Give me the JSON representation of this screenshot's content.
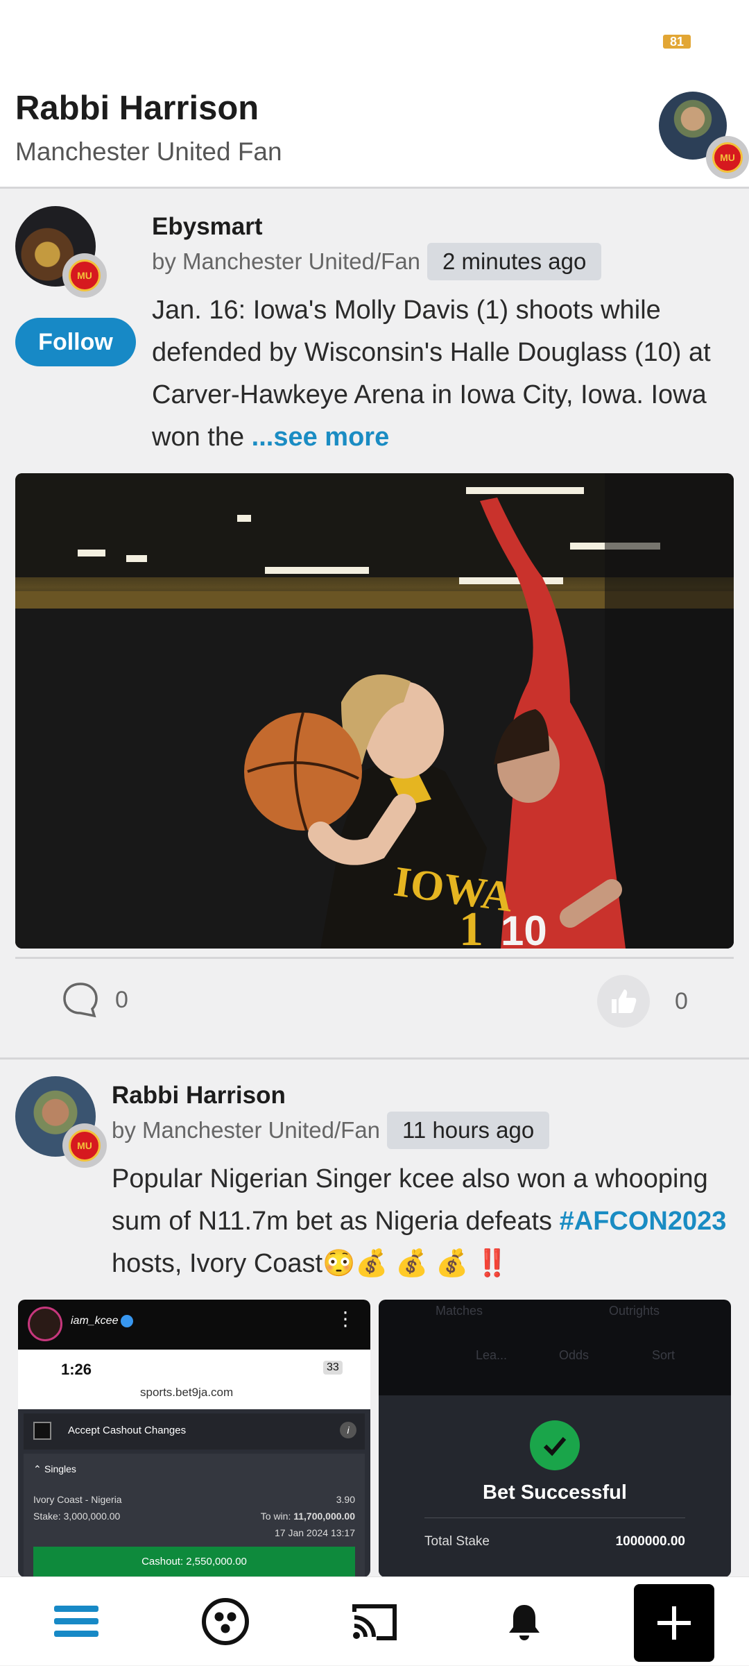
{
  "status": {
    "battery": "81"
  },
  "header": {
    "name": "Rabbi Harrison",
    "subtitle": "Manchester United Fan"
  },
  "posts": [
    {
      "author": "Ebysmart",
      "byline": "by Manchester United/Fan",
      "time": "2 minutes ago",
      "follow_label": "Follow",
      "text": "Jan. 16: Iowa's Molly Davis (1) shoots while defended by Wisconsin's Halle Douglass (10) at Carver-Hawkeye Arena in Iowa City, Iowa. Iowa won the",
      "see_more": "...see more",
      "comments": "0",
      "likes": "0",
      "jersey_text": "IOWA",
      "jersey_number": "1",
      "opponent_number": "10"
    },
    {
      "author": "Rabbi Harrison",
      "byline": "by Manchester United/Fan",
      "time": "11 hours ago",
      "text_before": "Popular Nigerian Singer kcee also won a whooping sum of N11.7m bet as Nigeria defeats",
      "hashtag": "#AFCON2023",
      "text_after": "hosts, Ivory Coast😳💰 💰 💰 ‼️"
    }
  ],
  "screenshot_left": {
    "account": "iam_kcee",
    "time": "1:26",
    "battery": "33",
    "url": "sports.bet9ja.com",
    "accept_label": "Accept Cashout Changes",
    "singles_label": "Singles",
    "match": "Ivory Coast - Nigeria",
    "odds": "3.90",
    "stake": "Stake: 3,000,000.00",
    "to_win_label": "To win:",
    "to_win_value": "11,700,000.00",
    "date": "17 Jan 2024 13:17",
    "cashout": "Cashout: 2,550,000.00"
  },
  "screenshot_right": {
    "tab_matches": "Matches",
    "tab_outrights": "Outrights",
    "filter_lea": "Lea...",
    "filter_odds": "Odds",
    "filter_sort": "Sort",
    "success_title": "Bet Successful",
    "total_stake_label": "Total Stake",
    "total_stake_value": "1000000.00"
  },
  "nav": {
    "items": [
      "feed-icon",
      "groups-icon",
      "cast-icon",
      "notifications-icon",
      "add-icon"
    ],
    "accent": "#1789c6"
  }
}
